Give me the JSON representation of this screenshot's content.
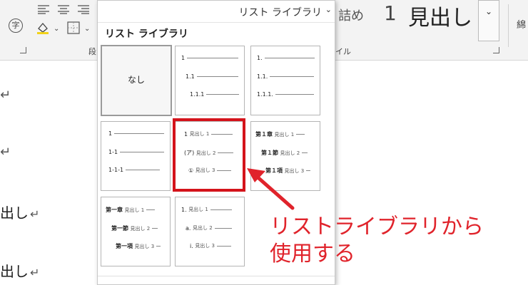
{
  "ribbon": {
    "format_glyph": "字",
    "paragraph_group_label": "段",
    "styles_group_label": "イル",
    "style_partial": "詰め",
    "heading_number": "1",
    "heading_text": "見出し",
    "side_glyph": "綿",
    "more_glyph": "⌄"
  },
  "dropdown": {
    "header_text": "リスト ライブラリ",
    "header_caret": "⌄",
    "title": "リスト ライブラリ",
    "none_label": "なし",
    "cells": [
      {
        "rows": [
          "1",
          "1.1",
          "1.1.1"
        ]
      },
      {
        "rows": [
          "1.",
          "1.1.",
          "1.1.1."
        ]
      },
      {
        "rows": [
          "1",
          "1-1",
          "1-1-1"
        ]
      },
      {
        "rows": [
          [
            "1",
            "見出し 1"
          ],
          [
            "(ア)",
            "見出し 2"
          ],
          [
            "①",
            "見出し 3"
          ]
        ]
      },
      {
        "rows": [
          [
            "第１章",
            "見出し 1"
          ],
          [
            "第１節",
            "見出し 2"
          ],
          [
            "第１項",
            "見出し 3"
          ]
        ]
      },
      {
        "rows": [
          [
            "第一章",
            "見出し 1"
          ],
          [
            "第一節",
            "見出し 2"
          ],
          [
            "第一項",
            "見出し 3"
          ]
        ]
      },
      {
        "rows": [
          [
            "1.",
            "見出し 1"
          ],
          [
            "a.",
            "見出し 2"
          ],
          [
            "i.",
            "見出し 3"
          ]
        ]
      }
    ]
  },
  "document": {
    "return_mark": "↵",
    "line3": "出し",
    "line4": "出し"
  },
  "callout": {
    "line1": "リストライブラリから",
    "line2": "使用する"
  },
  "colors": {
    "highlight": "#d4131b",
    "callout_text": "#e0232b"
  }
}
